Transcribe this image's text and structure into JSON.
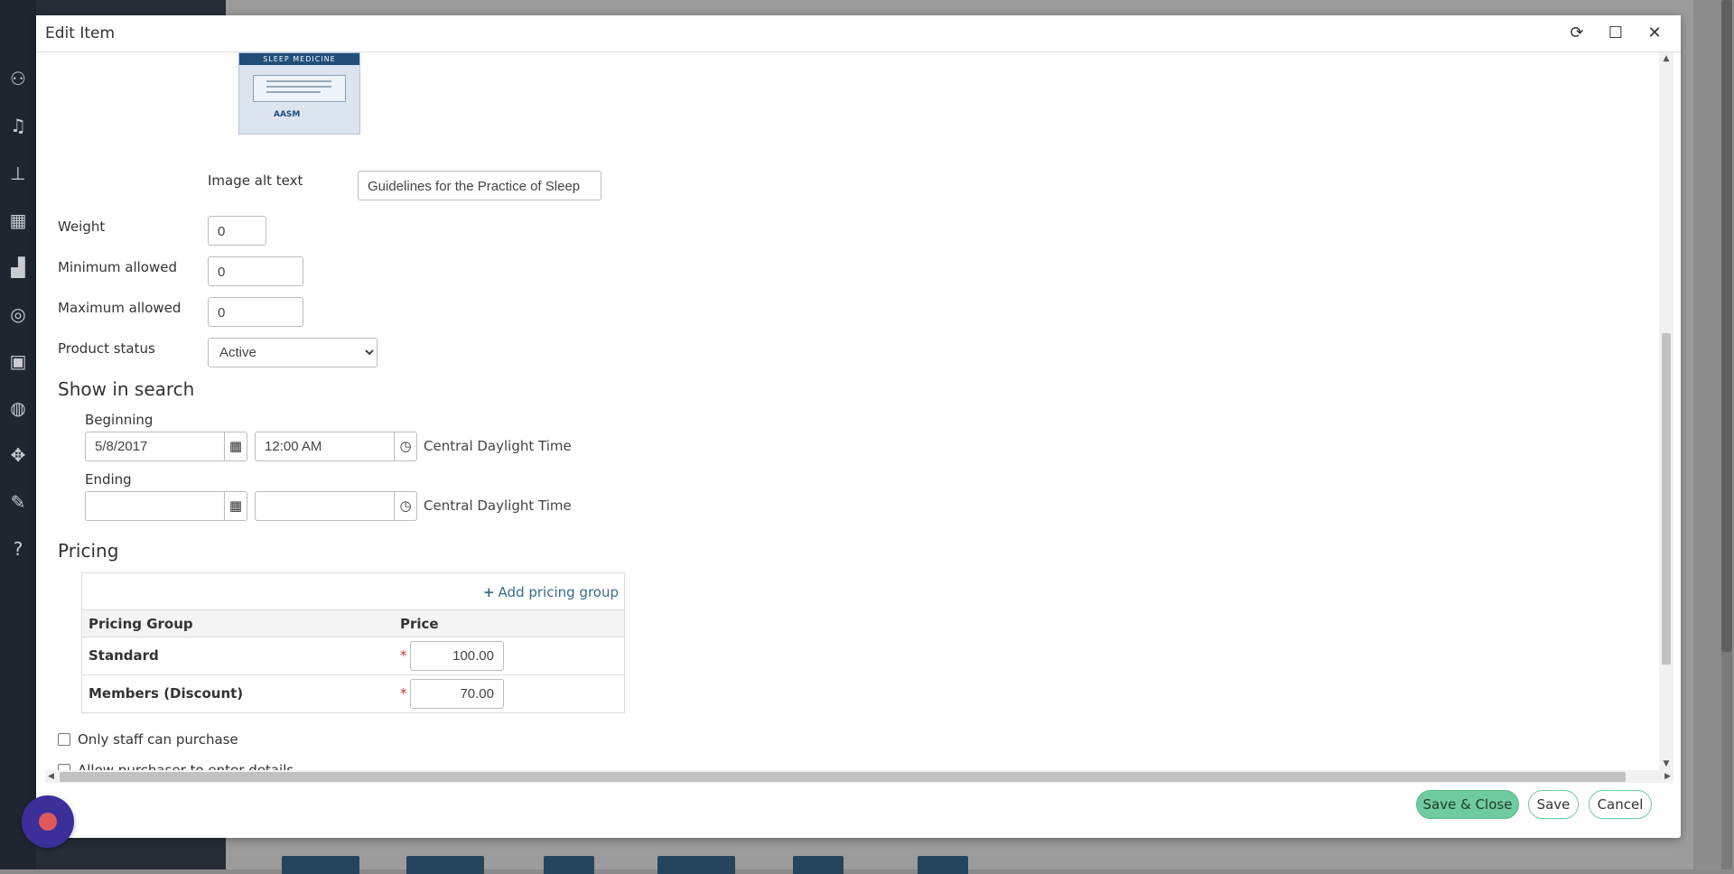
{
  "dialog": {
    "title": "Edit Item",
    "refresh_icon": "refresh-icon",
    "maximize_icon": "maximize-icon",
    "close_icon": "close-icon"
  },
  "book_cover": {
    "band_text": "SLEEP MEDICINE",
    "logo_text": "AASM"
  },
  "form": {
    "image_alt_label": "Image alt text",
    "image_alt_value": "Guidelines for the Practice of Sleep",
    "weight_label": "Weight",
    "weight_value": "0",
    "min_label": "Minimum allowed",
    "min_value": "0",
    "max_label": "Maximum allowed",
    "max_value": "0",
    "status_label": "Product status",
    "status_value": "Active"
  },
  "show_in_search": {
    "title": "Show in search",
    "beginning_label": "Beginning",
    "beginning_date": "5/8/2017",
    "beginning_time": "12:00 AM",
    "beginning_tz": "Central Daylight Time",
    "ending_label": "Ending",
    "ending_date": "",
    "ending_time": "",
    "ending_tz": "Central Daylight Time",
    "calendar_icon": "calendar-icon",
    "clock_icon": "clock-icon"
  },
  "pricing": {
    "title": "Pricing",
    "add_label": "Add pricing group",
    "columns": [
      "Pricing Group",
      "Price"
    ],
    "rows": [
      {
        "group": "Standard",
        "price": "100.00"
      },
      {
        "group": "Members (Discount)",
        "price": "70.00"
      }
    ]
  },
  "options": {
    "staff_only": "Only staff can purchase",
    "allow_details": "Allow purchaser to enter details"
  },
  "footer": {
    "save_close": "Save & Close",
    "save": "Save",
    "cancel": "Cancel"
  },
  "colors": {
    "accent": "#6fcb9f",
    "link": "#3a6a8e",
    "chat_bubble": "#3c2f9a"
  }
}
